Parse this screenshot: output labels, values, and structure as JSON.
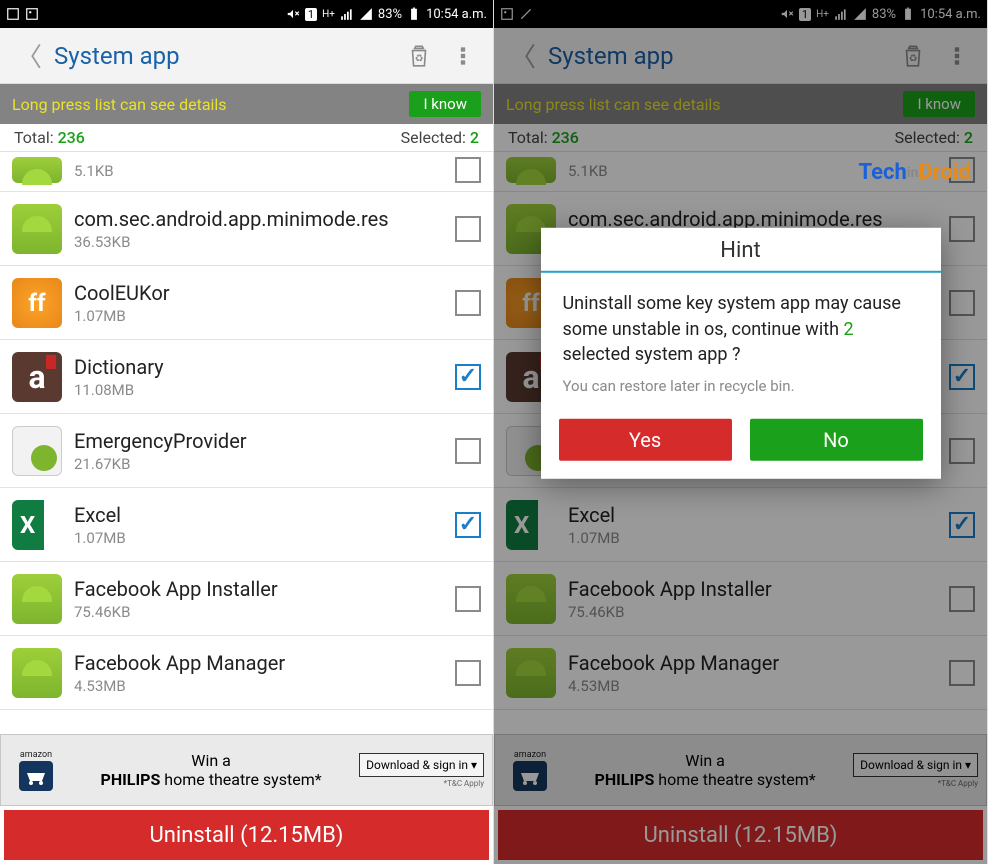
{
  "status": {
    "battery": "83%",
    "time": "10:54 a.m.",
    "net_badge": "1",
    "net_type": "H+"
  },
  "toolbar": {
    "title": "System app"
  },
  "hint": {
    "text": "Long press list can see details",
    "button": "I know"
  },
  "counts": {
    "total_label": "Total:",
    "total_value": "236",
    "selected_label": "Selected:",
    "selected_value": "2"
  },
  "apps": [
    {
      "name": "",
      "size": "5.1KB",
      "checked": false,
      "icon": "android"
    },
    {
      "name": "com.sec.android.app.minimode.res",
      "size": "36.53KB",
      "checked": false,
      "icon": "android"
    },
    {
      "name": "CoolEUKor",
      "size": "1.07MB",
      "checked": false,
      "icon": "cool"
    },
    {
      "name": "Dictionary",
      "size": "11.08MB",
      "checked": true,
      "icon": "dict"
    },
    {
      "name": "EmergencyProvider",
      "size": "21.67KB",
      "checked": false,
      "icon": "emerg"
    },
    {
      "name": "Excel",
      "size": "1.07MB",
      "checked": true,
      "icon": "excel"
    },
    {
      "name": "Facebook App Installer",
      "size": "75.46KB",
      "checked": false,
      "icon": "android"
    },
    {
      "name": "Facebook App Manager",
      "size": "4.53MB",
      "checked": false,
      "icon": "android"
    }
  ],
  "ad": {
    "brand_small": "amazon",
    "line1": "Win a",
    "brand_big": "PHILIPS",
    "line2": "home theatre system*",
    "button": "Download & sign in",
    "tc": "*T&C Apply"
  },
  "uninstall": {
    "label": "Uninstall (12.15MB)"
  },
  "dialog": {
    "title": "Hint",
    "body_1": "Uninstall some key system app may cause some unstable in os, continue with ",
    "body_count": "2",
    "body_2": " selected system app ?",
    "sub": "You can restore later in recycle bin.",
    "yes": "Yes",
    "no": "No"
  },
  "watermark": {
    "t1": "Tech",
    "t2": "in",
    "t3": "Droid"
  }
}
